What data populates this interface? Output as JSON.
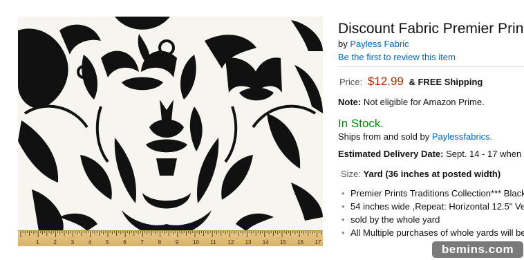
{
  "product": {
    "title": "Discount Fabric Premier Prints",
    "by_prefix": "by",
    "brand": "Payless Fabric",
    "review_link": "Be the first to review this item",
    "price_label": "Price:",
    "price": "$12.99",
    "shipping": "& FREE Shipping",
    "note_label": "Note:",
    "note_text": "Not eligible for Amazon Prime.",
    "stock": "In Stock.",
    "ships_prefix": "Ships from and sold by",
    "seller": "Paylessfabrics.",
    "delivery_label": "Estimated Delivery Date:",
    "delivery_text": "Sept. 14 - 17 when",
    "size_label": "Size:",
    "size_value": "Yard (36 inches at posted width)",
    "bullets": [
      "Premier Prints Traditions Collection*** Black",
      "54 inches wide ,Repeat: Horizontal 12.5\" Ve",
      "sold by the whole yard",
      "All Multiple purchases of whole yards will be"
    ]
  },
  "image": {
    "pattern_colors": {
      "ink": "#111111",
      "ground": "#f7f5ef",
      "ruler": "#dcb66f"
    },
    "ruler_numbers": [
      "1",
      "2",
      "3",
      "4",
      "5",
      "6",
      "7",
      "8",
      "9",
      "10",
      "11",
      "12",
      "13",
      "14",
      "15",
      "16",
      "17"
    ]
  },
  "watermark": "bemins.com"
}
